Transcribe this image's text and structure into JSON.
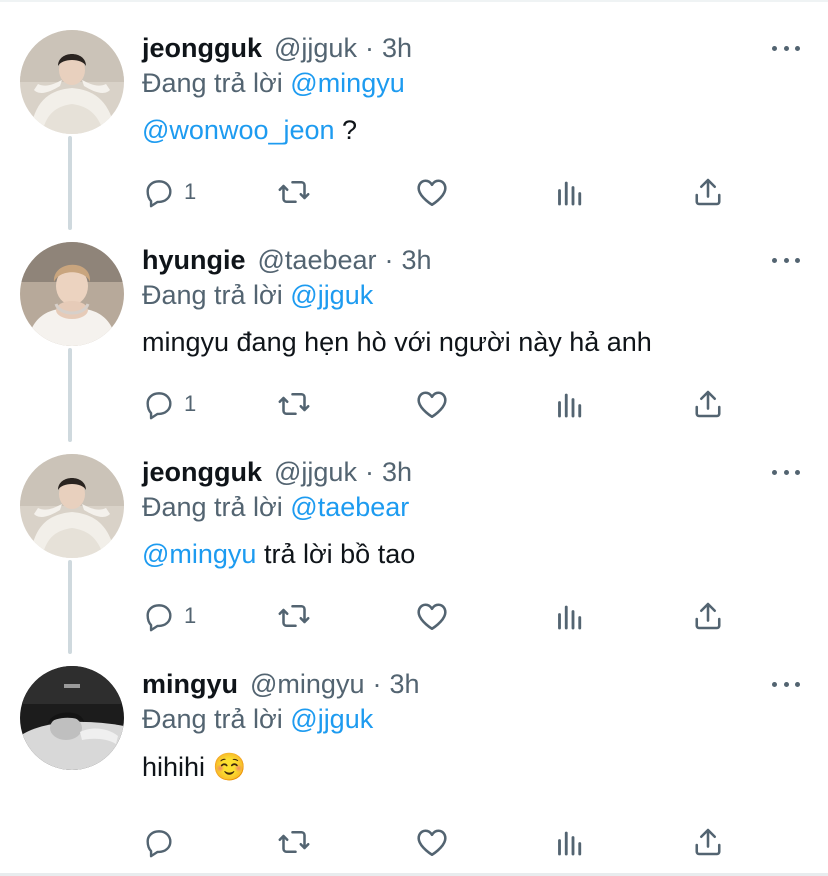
{
  "replying_prefix": "Đang trả lời",
  "tweets": [
    {
      "name": "jeongguk",
      "handle": "@jjguk",
      "time": "3h",
      "reply_to": "@mingyu",
      "text_mention": "@wonwoo_jeon",
      "text": " ?",
      "reply_count": "1",
      "avatar": "person-in-white-blanket-photo"
    },
    {
      "name": "hyungie",
      "handle": "@taebear",
      "time": "3h",
      "reply_to": "@jjguk",
      "text_mention": "",
      "text": "mingyu đang hẹn hò với người này hả anh",
      "reply_count": "1",
      "avatar": "person-white-shirt-hands-photo"
    },
    {
      "name": "jeongguk",
      "handle": "@jjguk",
      "time": "3h",
      "reply_to": "@taebear",
      "text_mention": "@mingyu",
      "text": " trả lời bồ tao",
      "reply_count": "1",
      "avatar": "person-in-white-blanket-photo"
    },
    {
      "name": "mingyu",
      "handle": "@mingyu",
      "time": "3h",
      "reply_to": "@jjguk",
      "text_mention": "",
      "text": "hihihi ☺️",
      "reply_count": "",
      "avatar": "black-and-white-person-photo"
    }
  ],
  "colors": {
    "link": "#1d9bf0",
    "secondary": "#536471",
    "primary": "#0f1419",
    "thread": "#cfd9de"
  },
  "icons": [
    "reply-icon",
    "retweet-icon",
    "like-icon",
    "analytics-icon",
    "share-icon",
    "more-icon"
  ]
}
